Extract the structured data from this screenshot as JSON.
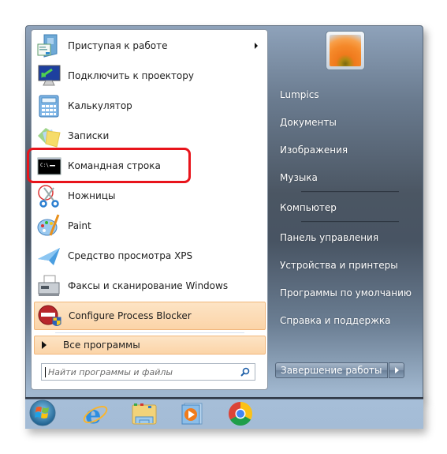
{
  "start_menu": {
    "pinned_items": [
      {
        "label": "Приступая к работе",
        "icon": "getting-started-icon",
        "has_submenu": true
      },
      {
        "label": "Подключить к проектору",
        "icon": "projector-icon",
        "has_submenu": false
      },
      {
        "label": "Калькулятор",
        "icon": "calculator-icon",
        "has_submenu": false
      },
      {
        "label": "Записки",
        "icon": "sticky-notes-icon",
        "has_submenu": false
      },
      {
        "label": "Командная строка",
        "icon": "command-prompt-icon",
        "has_submenu": false
      },
      {
        "label": "Ножницы",
        "icon": "snipping-tool-icon",
        "has_submenu": false
      },
      {
        "label": "Paint",
        "icon": "paint-icon",
        "has_submenu": false
      },
      {
        "label": "Средство просмотра XPS",
        "icon": "xps-viewer-icon",
        "has_submenu": false
      },
      {
        "label": "Факсы и сканирование Windows",
        "icon": "fax-scan-icon",
        "has_submenu": false
      },
      {
        "label": "Configure Process Blocker",
        "icon": "process-blocker-icon",
        "has_submenu": false,
        "highlighted": true
      }
    ],
    "all_programs_label": "Все программы",
    "search": {
      "placeholder": "Найти программы и файлы",
      "value": ""
    },
    "right_items": [
      {
        "label": "Lumpics"
      },
      {
        "label": "Документы"
      },
      {
        "label": "Изображения"
      },
      {
        "label": "Музыка"
      },
      {
        "label": "Компьютер"
      },
      {
        "label": "Панель управления"
      },
      {
        "label": "Устройства и принтеры"
      },
      {
        "label": "Программы по умолчанию"
      },
      {
        "label": "Справка и поддержка"
      }
    ],
    "shutdown_label": "Завершение работы",
    "user_picture": "flower-avatar"
  },
  "taskbar": {
    "items": [
      {
        "name": "start-orb",
        "icon": "windows-logo-icon"
      },
      {
        "name": "internet-explorer",
        "icon": "internet-explorer-icon"
      },
      {
        "name": "explorer",
        "icon": "folder-icon"
      },
      {
        "name": "media-player",
        "icon": "media-player-icon"
      },
      {
        "name": "chrome",
        "icon": "chrome-icon"
      }
    ]
  },
  "annotation": {
    "target": "Командная строка",
    "color": "#e8141b"
  },
  "colors": {
    "highlight_bg": "#fbd4a8",
    "highlight_border": "#f1b67b",
    "right_panel_dark": "#485463"
  }
}
